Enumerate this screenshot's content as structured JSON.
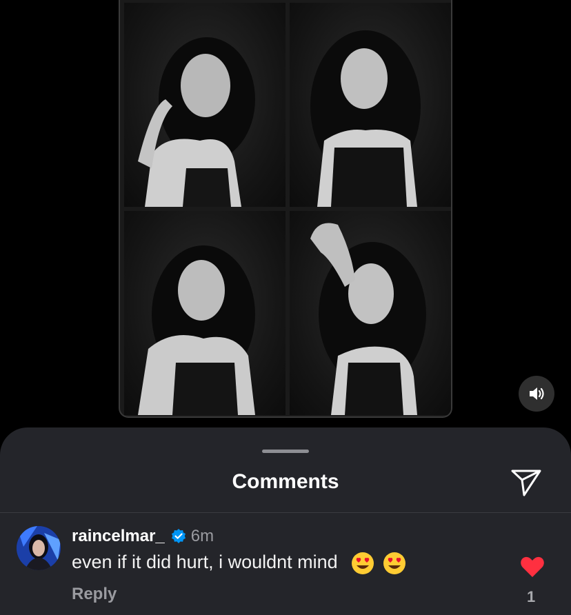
{
  "media": {
    "photos": [
      "photo-1",
      "photo-2",
      "photo-3",
      "photo-4"
    ],
    "sound_icon": "speaker-icon"
  },
  "sheet": {
    "title": "Comments",
    "share_icon": "send-icon"
  },
  "comment": {
    "username": "raincelmar_",
    "verified_icon": "verified-badge-icon",
    "time": "6m",
    "text": "even if it did hurt, i wouldnt mind",
    "emojis": [
      "heart-eyes-emoji",
      "heart-eyes-emoji"
    ],
    "reply_label": "Reply",
    "like_icon": "heart-icon",
    "like_count": "1",
    "colors": {
      "like": "#ff3040",
      "verified": "#0095f6"
    }
  }
}
